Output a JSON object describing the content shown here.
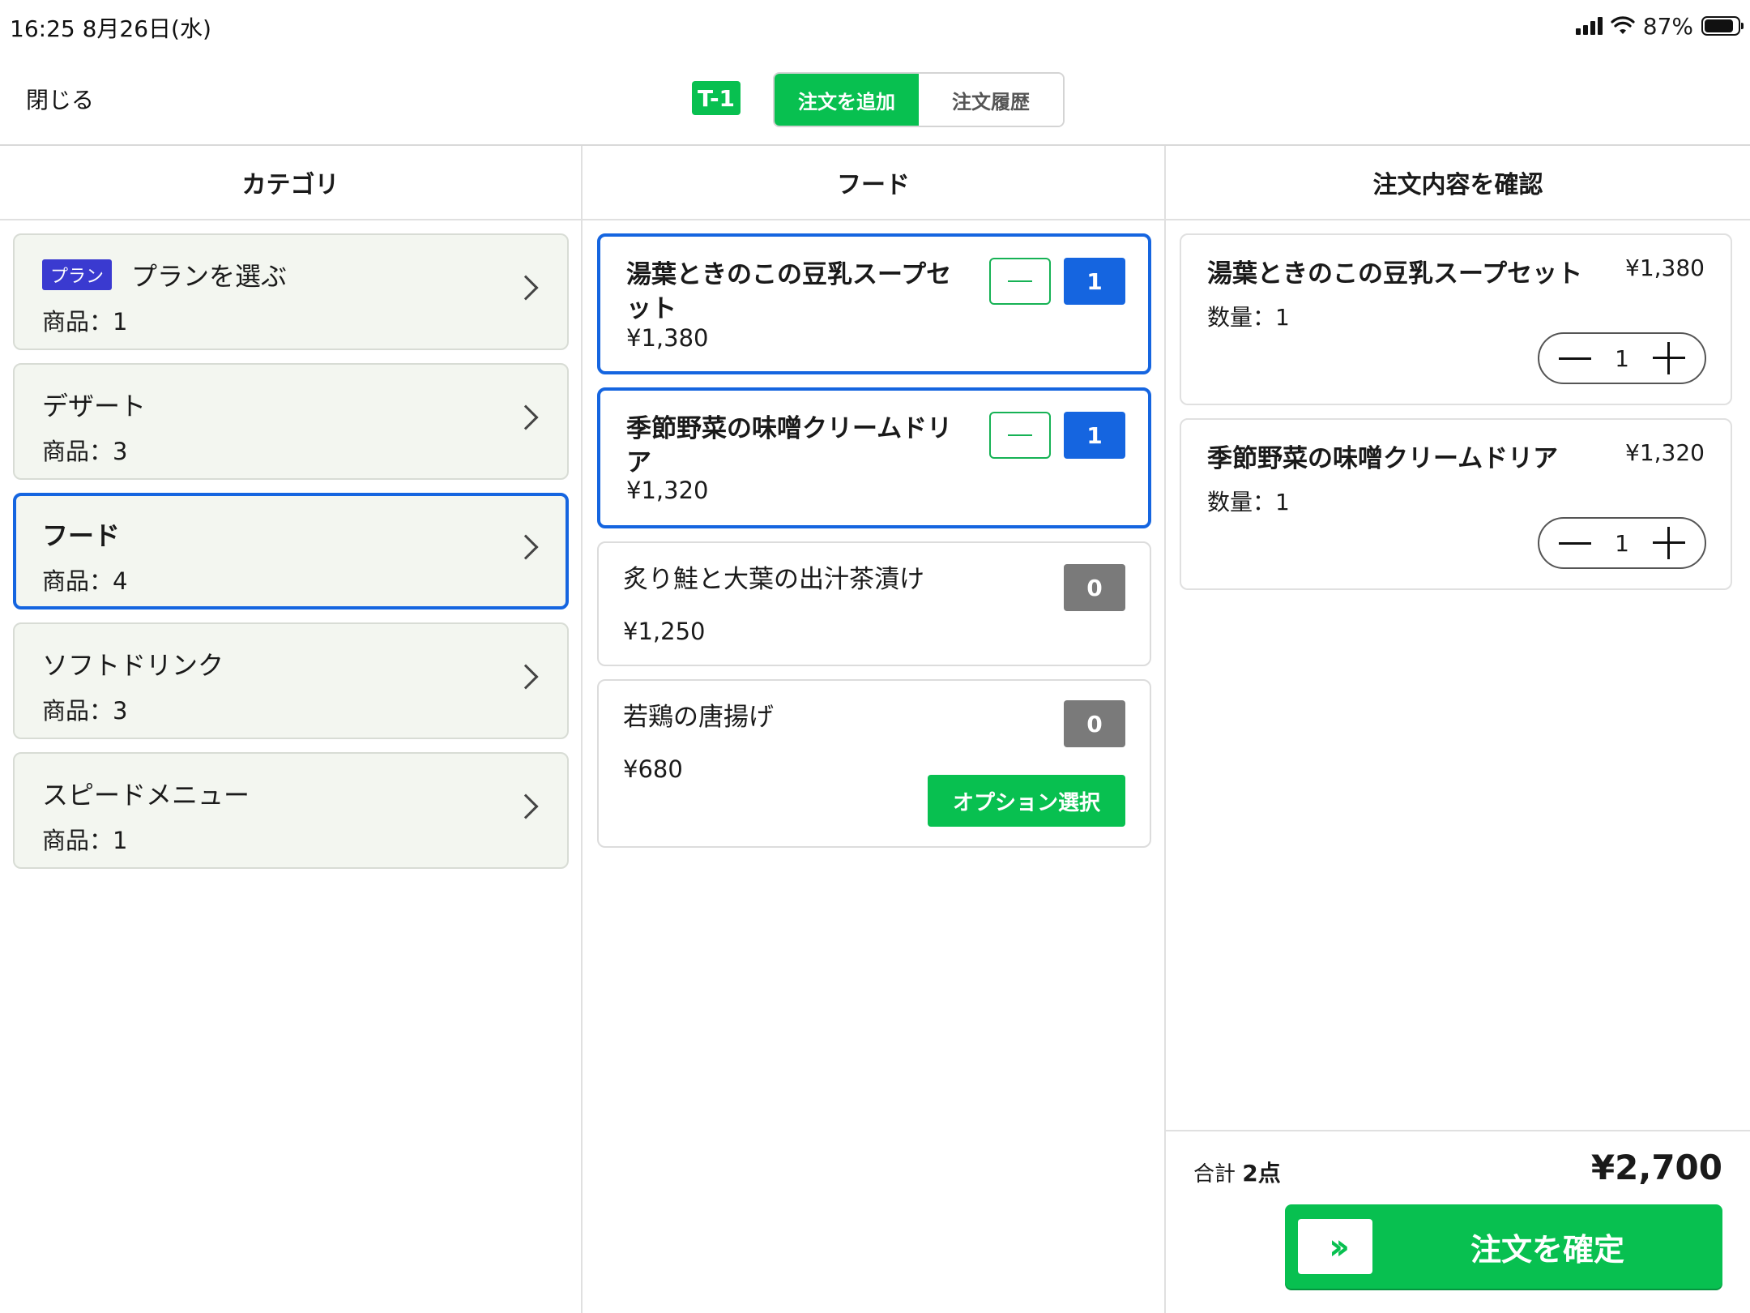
{
  "status_bar": {
    "time_date": "16:25   8月26日(水)",
    "battery": "87%",
    "battery_level": 0.87
  },
  "header": {
    "close_label": "閉じる",
    "table_badge": "T-1",
    "tab_add_order": "注文を追加",
    "tab_order_history": "注文履歴",
    "active_tab": "注文を追加"
  },
  "columns": {
    "category_title": "カテゴリ",
    "products_title": "フード",
    "order_title": "注文内容を確認"
  },
  "categories": [
    {
      "badge": "プラン",
      "name": "プランを選ぶ",
      "count": "商品：1",
      "selected": false
    },
    {
      "name": "デザート",
      "count": "商品：3",
      "selected": false
    },
    {
      "name": "フード",
      "count": "商品：4",
      "selected": true
    },
    {
      "name": "ソフトドリンク",
      "count": "商品：3",
      "selected": false
    },
    {
      "name": "スピードメニュー",
      "count": "商品：1",
      "selected": false
    }
  ],
  "products": [
    {
      "name": "湯葉ときのこの豆乳スープセット",
      "price": "¥1,380",
      "qty": "1",
      "selected": true
    },
    {
      "name": "季節野菜の味噌クリームドリア",
      "price": "¥1,320",
      "qty": "1",
      "selected": true
    },
    {
      "name": "炙り鮭と大葉の出汁茶漬け",
      "price": "¥1,250",
      "qty": "0",
      "selected": false
    },
    {
      "name": "若鶏の唐揚げ",
      "price": "¥680",
      "qty": "0",
      "selected": false,
      "option_button": "オプション選択"
    }
  ],
  "order_items": [
    {
      "name": "湯葉ときのこの豆乳スープセット",
      "price": "¥1,380",
      "qty_label": "数量：1",
      "qty": "1"
    },
    {
      "name": "季節野菜の味噌クリームドリア",
      "price": "¥1,320",
      "qty_label": "数量：1",
      "qty": "1"
    }
  ],
  "footer": {
    "total_label": "合計",
    "total_count": "2点",
    "total_amount": "¥2,700",
    "confirm_label": "注文を確定",
    "confirm_icon": "double-chevron-right-icon"
  },
  "colors": {
    "accent_green": "#08c050",
    "selection_blue": "#1565e0",
    "plan_badge": "#3a3ad0"
  }
}
